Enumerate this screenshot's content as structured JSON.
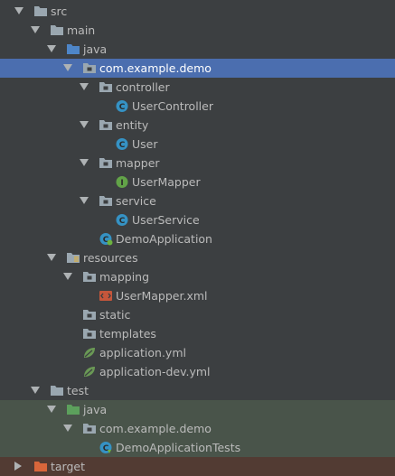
{
  "tree": {
    "nodes": [
      {
        "label": "src",
        "icon": "folder-icon",
        "expanded": true
      },
      {
        "label": "main",
        "icon": "folder-icon",
        "expanded": true
      },
      {
        "label": "java",
        "icon": "source-root-folder-icon",
        "expanded": true
      },
      {
        "label": "com.example.demo",
        "icon": "package-icon",
        "expanded": true,
        "selected": true
      },
      {
        "label": "controller",
        "icon": "package-icon",
        "expanded": true
      },
      {
        "label": "UserController",
        "icon": "class-icon"
      },
      {
        "label": "entity",
        "icon": "package-icon",
        "expanded": true
      },
      {
        "label": "User",
        "icon": "class-icon"
      },
      {
        "label": "mapper",
        "icon": "package-icon",
        "expanded": true
      },
      {
        "label": "UserMapper",
        "icon": "interface-icon"
      },
      {
        "label": "service",
        "icon": "package-icon",
        "expanded": true
      },
      {
        "label": "UserService",
        "icon": "class-icon"
      },
      {
        "label": "DemoApplication",
        "icon": "spring-boot-class-icon"
      },
      {
        "label": "resources",
        "icon": "resources-root-folder-icon",
        "expanded": true
      },
      {
        "label": "mapping",
        "icon": "package-icon",
        "expanded": true
      },
      {
        "label": "UserMapper.xml",
        "icon": "xml-file-icon"
      },
      {
        "label": "static",
        "icon": "package-icon"
      },
      {
        "label": "templates",
        "icon": "package-icon"
      },
      {
        "label": "application.yml",
        "icon": "spring-yml-icon"
      },
      {
        "label": "application-dev.yml",
        "icon": "spring-yml-icon"
      },
      {
        "label": "test",
        "icon": "folder-icon",
        "expanded": true
      },
      {
        "label": "java",
        "icon": "test-source-root-folder-icon",
        "expanded": true
      },
      {
        "label": "com.example.demo",
        "icon": "package-icon",
        "expanded": true
      },
      {
        "label": "DemoApplicationTests",
        "icon": "test-class-icon"
      },
      {
        "label": "target",
        "icon": "excluded-folder-icon",
        "expanded": false
      }
    ]
  },
  "colors": {
    "background": "#3c3f41",
    "selection": "#4b6eaf",
    "test_band": "#49544a",
    "excluded_band": "#523b33",
    "text": "#bbbbbb",
    "folder": "#9aa7b0",
    "source_root": "#4e86c8",
    "test_root": "#5ca05c",
    "excluded": "#d9663b",
    "class_badge": "#3592c4",
    "interface_badge": "#62a348"
  }
}
